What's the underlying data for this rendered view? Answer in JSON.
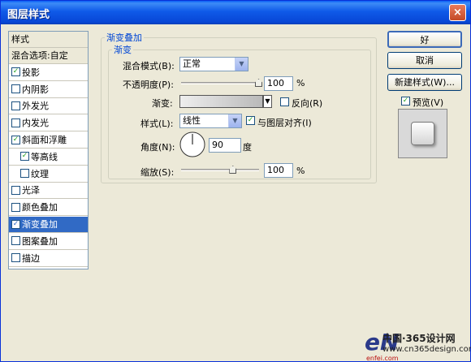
{
  "window": {
    "title": "图层样式",
    "close_glyph": "×"
  },
  "style_list": {
    "header": "样式",
    "items": [
      {
        "label": "混合选项:自定",
        "checkbox": false,
        "checked": false,
        "header": true
      },
      {
        "label": "投影",
        "checkbox": true,
        "checked": true
      },
      {
        "label": "内阴影",
        "checkbox": true,
        "checked": false
      },
      {
        "label": "外发光",
        "checkbox": true,
        "checked": false
      },
      {
        "label": "内发光",
        "checkbox": true,
        "checked": false
      },
      {
        "label": "斜面和浮雕",
        "checkbox": true,
        "checked": true
      },
      {
        "label": "等高线",
        "checkbox": true,
        "checked": true,
        "indent": true
      },
      {
        "label": "纹理",
        "checkbox": true,
        "checked": false,
        "indent": true
      },
      {
        "label": "光泽",
        "checkbox": true,
        "checked": false
      },
      {
        "label": "颜色叠加",
        "checkbox": true,
        "checked": false
      },
      {
        "label": "渐变叠加",
        "checkbox": true,
        "checked": true,
        "selected": true
      },
      {
        "label": "图案叠加",
        "checkbox": true,
        "checked": false
      },
      {
        "label": "描边",
        "checkbox": true,
        "checked": false
      }
    ]
  },
  "panel": {
    "outer_title": "渐变叠加",
    "inner_title": "渐变",
    "blend_mode_label": "混合模式(B):",
    "blend_mode_value": "正常",
    "opacity_label": "不透明度(P):",
    "opacity_value": "100",
    "opacity_unit": "%",
    "opacity_level": 1.0,
    "gradient_label": "渐变:",
    "reverse_label": "反向(R)",
    "reverse_checked": false,
    "style_label": "样式(L):",
    "style_value": "线性",
    "align_label": "与图层对齐(I)",
    "align_checked": true,
    "angle_label": "角度(N):",
    "angle_value": "90",
    "angle_unit": "度",
    "scale_label": "缩放(S):",
    "scale_value": "100",
    "scale_unit": "%",
    "scale_level": 0.67
  },
  "buttons": {
    "ok": "好",
    "cancel": "取消",
    "new_style": "新建样式(W)...",
    "preview_label": "预览(V)",
    "preview_checked": true
  },
  "watermark": {
    "logo": "eN",
    "site_cn": "中国·365设计网",
    "site_url": "www.cn365design.com",
    "site_url2": "enfei.com"
  },
  "colors": {
    "title_blue": "#0a5ef5",
    "selected": "#316ac5",
    "group_label": "#0046d5"
  }
}
